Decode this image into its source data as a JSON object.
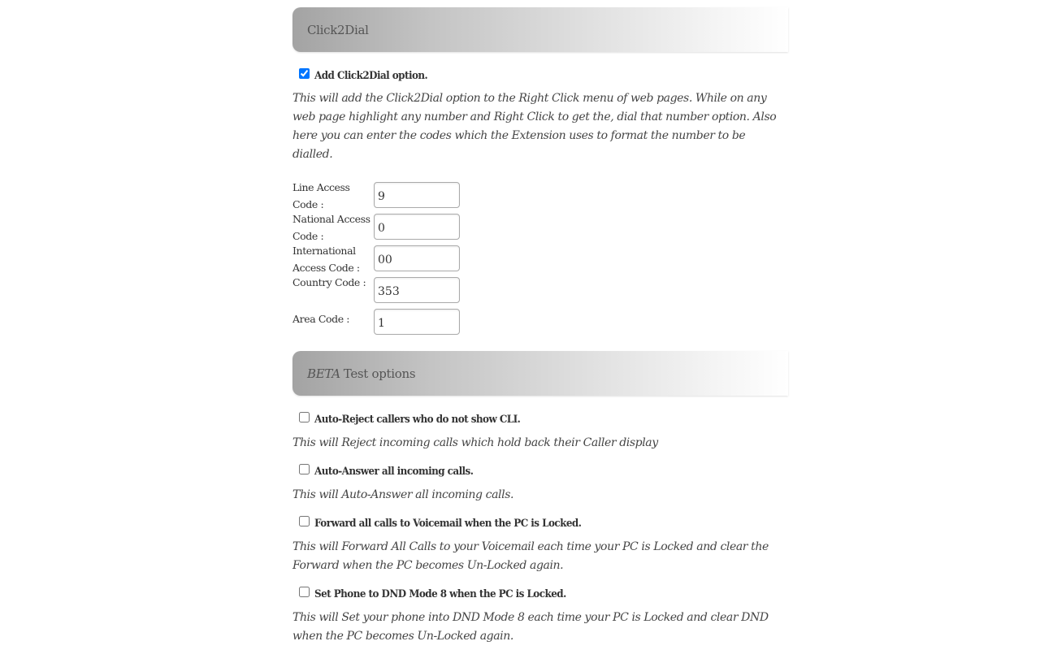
{
  "click2dial": {
    "header": "Click2Dial",
    "option": {
      "label": "Add Click2Dial option.",
      "checked": true,
      "description": "This will add the Click2Dial option to the Right Click menu of web pages. While on any web page highlight any number and Right Click to get the, dial that number option. Also here you can enter the codes which the Extension uses to format the number to be dialled."
    },
    "fields": [
      {
        "label": "Line Access Code :",
        "value": "9"
      },
      {
        "label": "National Access Code :",
        "value": "0"
      },
      {
        "label": "International Access Code :",
        "value": "00"
      },
      {
        "label": "Country Code :",
        "value": "353"
      },
      {
        "label": "Area Code :",
        "value": "1"
      }
    ]
  },
  "beta": {
    "header_em": "BETA",
    "header_rest": "Test options",
    "options": [
      {
        "label": "Auto-Reject callers who do not show CLI.",
        "checked": false,
        "description": "This will Reject incoming calls which hold back their Caller display"
      },
      {
        "label": "Auto-Answer all incoming calls.",
        "checked": false,
        "description": "This will Auto-Answer all incoming calls."
      },
      {
        "label": "Forward all calls to Voicemail when the PC is Locked.",
        "checked": false,
        "description": "This will Forward All Calls to your Voicemail each time your PC is Locked and clear the Forward when the PC becomes Un-Locked again."
      },
      {
        "label": "Set Phone to DND Mode 8 when the PC is Locked.",
        "checked": false,
        "description": "This will Set your phone into DND Mode 8 each time your PC is Locked and clear DND when the PC becomes Un-Locked again."
      }
    ]
  }
}
